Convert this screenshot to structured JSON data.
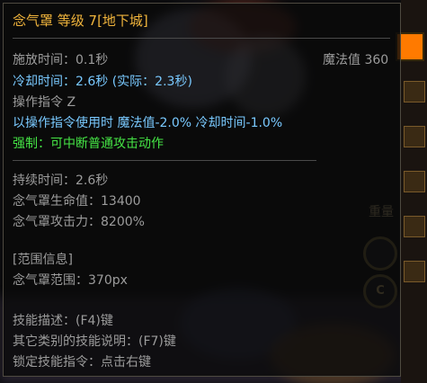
{
  "tooltip": {
    "title": "念气罩 等级 7[地下城]",
    "cast_time": "施放时间：0.1秒",
    "mana_label": "魔法值 360",
    "cooldown": "冷却时间：2.6秒 (实际：2.3秒)",
    "command": "操作指令 Z",
    "command_effect": "以操作指令使用时 魔法值-2.0% 冷却时间-1.0%",
    "force": "强制：可中断普通攻击动作",
    "duration": "持续时间：2.6秒",
    "shield_hp": "念气罩生命值：13400",
    "shield_atk": "念气罩攻击力：8200%",
    "range_header": "[范围信息]",
    "range_value": "念气罩范围：370px",
    "desc_key": "技能描述：(F4)键",
    "other_desc_key": "其它类别的技能说明：(F7)键",
    "lock_key": "锁定技能指令：点击右键"
  },
  "background": {
    "key_heavy": "重量",
    "ring_label": "C"
  },
  "colors": {
    "gray_text": "#9c9c9c",
    "orange_text": "#f0b43c",
    "blue_text": "#79c9ff",
    "green_text": "#45e545",
    "accent_orange": "#ff7a00"
  }
}
